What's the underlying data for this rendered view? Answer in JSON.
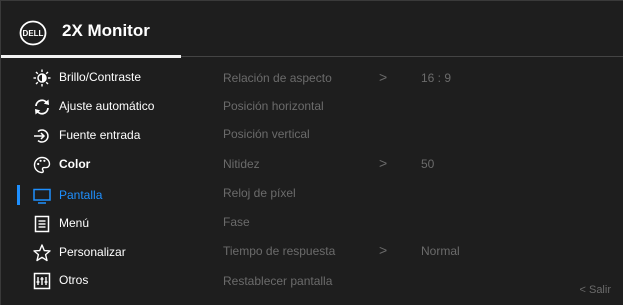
{
  "header": {
    "logo_text": "DELL",
    "title": "2X Monitor"
  },
  "sidebar": {
    "items": [
      {
        "label": "Brillo/Contraste",
        "icon": "brightness-icon"
      },
      {
        "label": "Ajuste automático",
        "icon": "auto-adjust-icon"
      },
      {
        "label": "Fuente entrada",
        "icon": "input-source-icon"
      },
      {
        "label": "Color",
        "icon": "color-palette-icon"
      },
      {
        "label": "Pantalla",
        "icon": "display-icon"
      },
      {
        "label": "Menú",
        "icon": "menu-icon"
      },
      {
        "label": "Personalizar",
        "icon": "star-icon"
      },
      {
        "label": "Otros",
        "icon": "others-icon"
      }
    ],
    "selected": "Pantalla"
  },
  "content": {
    "rows": [
      {
        "label": "Relación de aspecto",
        "has_submenu": true,
        "value": "16 : 9"
      },
      {
        "label": "Posición horizontal",
        "has_submenu": false,
        "value": ""
      },
      {
        "label": "Posición vertical",
        "has_submenu": false,
        "value": ""
      },
      {
        "label": "Nitidez",
        "has_submenu": true,
        "value": "50"
      },
      {
        "label": "Reloj de píxel",
        "has_submenu": false,
        "value": ""
      },
      {
        "label": "Fase",
        "has_submenu": false,
        "value": ""
      },
      {
        "label": "Tiempo de respuesta",
        "has_submenu": true,
        "value": "Normal"
      },
      {
        "label": "Restablecer pantalla",
        "has_submenu": false,
        "value": ""
      }
    ],
    "chevron": ">"
  },
  "footer": {
    "exit_label": "< Salir"
  },
  "colors": {
    "background": "#1e1e1e",
    "accent": "#1e90ff",
    "inactive_text": "#6b6b6b",
    "text": "#ffffff"
  }
}
